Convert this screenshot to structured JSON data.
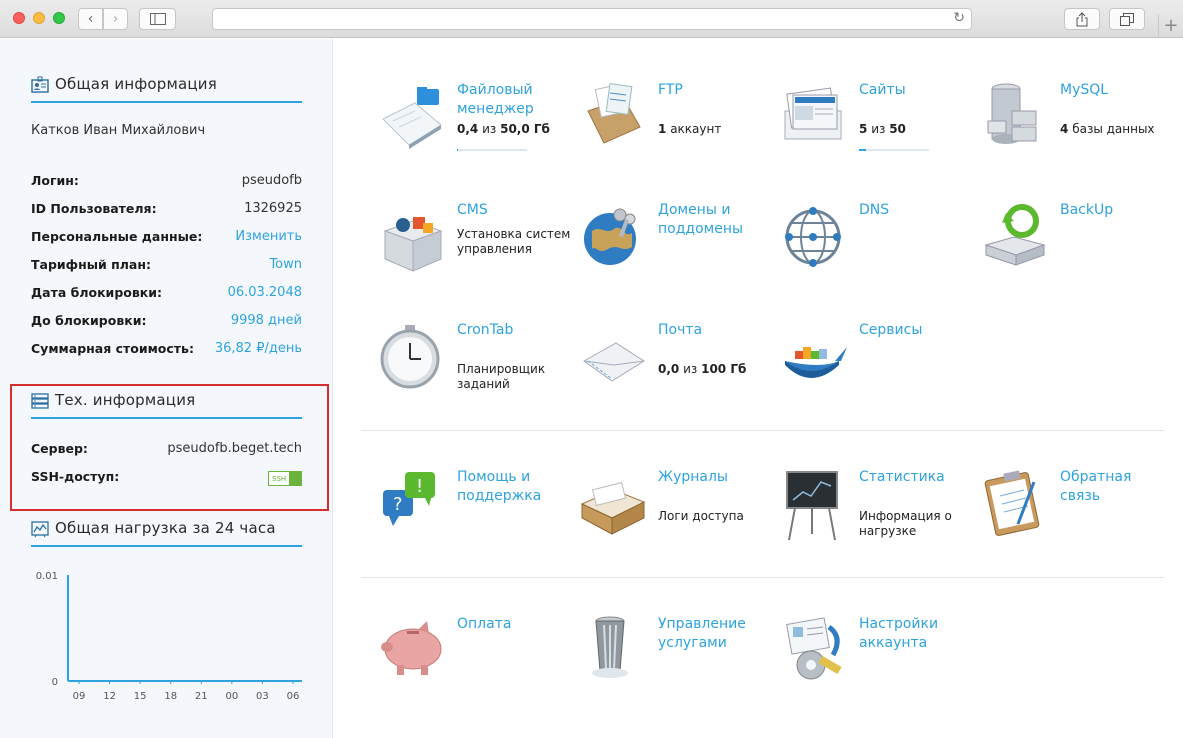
{
  "chrome": {
    "back_glyph": "‹",
    "forward_glyph": "›",
    "newtab_glyph": "+",
    "reload_glyph": "↻"
  },
  "left": {
    "general": {
      "title": "Общая информация",
      "full_name": "Катков Иван Михайлович",
      "rows": [
        {
          "k": "Логин:",
          "v": "pseudofb",
          "link": false
        },
        {
          "k": "ID Пользователя:",
          "v": "1326925",
          "link": false
        },
        {
          "k": "Персональные данные:",
          "v": "Изменить",
          "link": true
        },
        {
          "k": "Тарифный план:",
          "v": "Town",
          "link": true
        },
        {
          "k": "Дата блокировки:",
          "v": "06.03.2048",
          "link": true
        },
        {
          "k": "До блокировки:",
          "v": "9998 дней",
          "link": true
        },
        {
          "k": "Суммарная стоимость:",
          "v": "36,82 ₽/день",
          "link": true
        }
      ]
    },
    "tech": {
      "title": "Тех. информация",
      "server_label": "Сервер:",
      "server_value": "pseudofb.beget.tech",
      "ssh_label": "SSH-доступ:",
      "ssh_toggle_text": "SSH",
      "ssh_enabled": true
    },
    "load": {
      "title": "Общая нагрузка за 24 часа"
    }
  },
  "chart_data": {
    "type": "line",
    "title": "Общая нагрузка за 24 часа",
    "categories": [
      "09",
      "12",
      "15",
      "18",
      "21",
      "00",
      "03",
      "06"
    ],
    "y_ticks": [
      "0.01",
      "0"
    ],
    "ylim": [
      0,
      0.01
    ],
    "series": [
      {
        "values": [
          0,
          0,
          0,
          0,
          0,
          0,
          0,
          0
        ]
      }
    ],
    "grid": false
  },
  "services": {
    "files": {
      "name": "Файловый менеджер",
      "used": "0,4",
      "sep": "из",
      "total": "50,0 Гб"
    },
    "ftp": {
      "name": "FTP",
      "count": "1",
      "unit": "аккаунт"
    },
    "sites": {
      "name": "Сайты",
      "used": "5",
      "sep": "из",
      "total": "50",
      "usage_fraction": 0.1
    },
    "mysql": {
      "name": "MySQL",
      "count": "4",
      "unit": "базы данных"
    },
    "cms": {
      "name": "CMS",
      "sub": "Установка систем управления"
    },
    "domains": {
      "name": "Домены и поддомены"
    },
    "dns": {
      "name": "DNS"
    },
    "backup": {
      "name": "BackUp"
    },
    "cron": {
      "name": "CronTab",
      "sub": "Планировщик заданий"
    },
    "mail": {
      "name": "Почта",
      "used": "0,0",
      "sep": "из",
      "total": "100 Гб"
    },
    "services": {
      "name": "Сервисы"
    },
    "help": {
      "name": "Помощь и поддержка"
    },
    "logs": {
      "name": "Журналы",
      "sub": "Логи доступа"
    },
    "stats": {
      "name": "Статистика",
      "sub": "Информация о нагрузке"
    },
    "feedback": {
      "name": "Обратная связь"
    },
    "payment": {
      "name": "Оплата"
    },
    "manage": {
      "name": "Управление услугами"
    },
    "account": {
      "name": "Настройки аккаунта"
    }
  },
  "colors": {
    "accent": "#2ea3de",
    "highlight_box": "#d32f2f",
    "ssh_on": "#6cb33e"
  }
}
